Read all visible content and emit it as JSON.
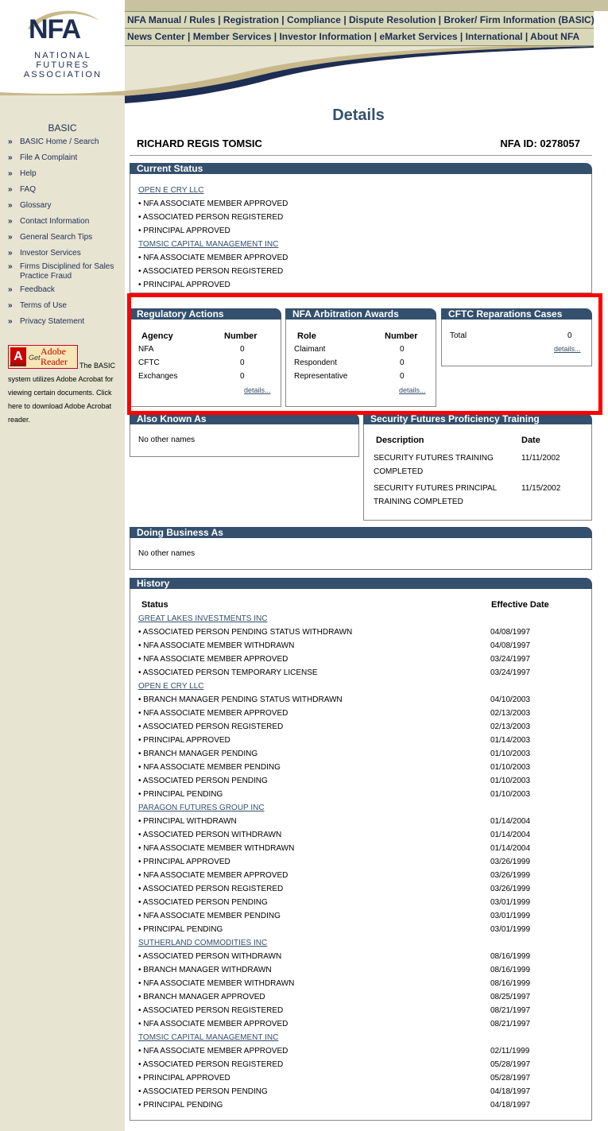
{
  "logo": {
    "mark": "NFA",
    "line1": "NATIONAL",
    "line2": "FUTURES",
    "line3": "ASSOCIATION"
  },
  "nav": {
    "row1": "NFA Manual / Rules | Registration | Compliance | Dispute Resolution | Broker/ Firm Information (BASIC)",
    "row2": "News Center | Member Services | Investor Information | eMarket Services | International | About NFA"
  },
  "sidebar": {
    "title": "BASIC",
    "items": [
      "BASIC Home / Search",
      "File A Complaint",
      "Help",
      "FAQ",
      "Glossary",
      "Contact Information",
      "General Search Tips",
      "Investor Services",
      "Firms Disciplined for Sales Practice Fraud",
      "Feedback",
      "Terms of Use",
      "Privacy Statement"
    ],
    "adobe": {
      "a": "A",
      "get": "Get",
      "reader": "Adobe Reader",
      "small": "Adobe",
      "text": "The BASIC system utilizes Adobe Acrobat for viewing certain documents. Click here to download Adobe Acrobat reader."
    }
  },
  "page": {
    "title": "Details",
    "name": "RICHARD REGIS TOMSIC",
    "nfa_id": "NFA ID: 0278057"
  },
  "current_status": {
    "title": "Current Status",
    "lines": [
      {
        "text": "OPEN E CRY LLC",
        "link": true
      },
      {
        "text": "• NFA ASSOCIATE MEMBER APPROVED",
        "link": false
      },
      {
        "text": "• ASSOCIATED PERSON REGISTERED",
        "link": false
      },
      {
        "text": "• PRINCIPAL APPROVED",
        "link": false
      },
      {
        "text": "TOMSIC CAPITAL MANAGEMENT INC",
        "link": true
      },
      {
        "text": "• NFA ASSOCIATE MEMBER APPROVED",
        "link": false
      },
      {
        "text": "• ASSOCIATED PERSON REGISTERED",
        "link": false
      },
      {
        "text": "• PRINCIPAL APPROVED",
        "link": false
      }
    ]
  },
  "regulatory": {
    "title": "Regulatory Actions",
    "col1": "Agency",
    "col2": "Number",
    "rows": [
      [
        "NFA",
        "0"
      ],
      [
        "CFTC",
        "0"
      ],
      [
        "Exchanges",
        "0"
      ]
    ],
    "details": "details..."
  },
  "arbitration": {
    "title": "NFA Arbitration Awards",
    "col1": "Role",
    "col2": "Number",
    "rows": [
      [
        "Claimant",
        "0"
      ],
      [
        "Respondent",
        "0"
      ],
      [
        "Representative",
        "0"
      ]
    ],
    "details": "details..."
  },
  "cftc": {
    "title": "CFTC Reparations Cases",
    "label": "Total",
    "value": "0",
    "details": "details..."
  },
  "aka": {
    "title": "Also Known As",
    "text": "No other names"
  },
  "training": {
    "title": "Security Futures Proficiency Training",
    "col1": "Description",
    "col2": "Date",
    "rows": [
      {
        "desc1": "SECURITY FUTURES TRAINING",
        "desc2": "COMPLETED",
        "date": "11/11/2002"
      },
      {
        "desc1": "SECURITY FUTURES PRINCIPAL",
        "desc2": "TRAINING COMPLETED",
        "date": "11/15/2002"
      }
    ]
  },
  "dba": {
    "title": "Doing Business As",
    "text": "No other names"
  },
  "history": {
    "title": "History",
    "col1": "Status",
    "col2": "Effective Date",
    "rows": [
      {
        "text": "GREAT LAKES INVESTMENTS INC",
        "link": true,
        "date": ""
      },
      {
        "text": "• ASSOCIATED PERSON PENDING STATUS WITHDRAWN",
        "link": false,
        "date": "04/08/1997"
      },
      {
        "text": "• NFA ASSOCIATE MEMBER WITHDRAWN",
        "link": false,
        "date": "04/08/1997"
      },
      {
        "text": "• NFA ASSOCIATE MEMBER APPROVED",
        "link": false,
        "date": "03/24/1997"
      },
      {
        "text": "• ASSOCIATED PERSON TEMPORARY LICENSE",
        "link": false,
        "date": "03/24/1997"
      },
      {
        "text": "OPEN E CRY LLC",
        "link": true,
        "date": ""
      },
      {
        "text": "• BRANCH MANAGER PENDING STATUS WITHDRAWN",
        "link": false,
        "date": "04/10/2003"
      },
      {
        "text": "• NFA ASSOCIATE MEMBER APPROVED",
        "link": false,
        "date": "02/13/2003"
      },
      {
        "text": "• ASSOCIATED PERSON REGISTERED",
        "link": false,
        "date": "02/13/2003"
      },
      {
        "text": "• PRINCIPAL APPROVED",
        "link": false,
        "date": "01/14/2003"
      },
      {
        "text": "• BRANCH MANAGER PENDING",
        "link": false,
        "date": "01/10/2003"
      },
      {
        "text": "• NFA ASSOCIATE MEMBER PENDING",
        "link": false,
        "date": "01/10/2003"
      },
      {
        "text": "• ASSOCIATED PERSON PENDING",
        "link": false,
        "date": "01/10/2003"
      },
      {
        "text": "• PRINCIPAL PENDING",
        "link": false,
        "date": "01/10/2003"
      },
      {
        "text": "PARAGON FUTURES GROUP INC",
        "link": true,
        "date": ""
      },
      {
        "text": "• PRINCIPAL WITHDRAWN",
        "link": false,
        "date": "01/14/2004"
      },
      {
        "text": "• ASSOCIATED PERSON WITHDRAWN",
        "link": false,
        "date": "01/14/2004"
      },
      {
        "text": "• NFA ASSOCIATE MEMBER WITHDRAWN",
        "link": false,
        "date": "01/14/2004"
      },
      {
        "text": "• PRINCIPAL APPROVED",
        "link": false,
        "date": "03/26/1999"
      },
      {
        "text": "• NFA ASSOCIATE MEMBER APPROVED",
        "link": false,
        "date": "03/26/1999"
      },
      {
        "text": "• ASSOCIATED PERSON REGISTERED",
        "link": false,
        "date": "03/26/1999"
      },
      {
        "text": "• ASSOCIATED PERSON PENDING",
        "link": false,
        "date": "03/01/1999"
      },
      {
        "text": "• NFA ASSOCIATE MEMBER PENDING",
        "link": false,
        "date": "03/01/1999"
      },
      {
        "text": "• PRINCIPAL PENDING",
        "link": false,
        "date": "03/01/1999"
      },
      {
        "text": "SUTHERLAND COMMODITIES INC",
        "link": true,
        "date": ""
      },
      {
        "text": "• ASSOCIATED PERSON WITHDRAWN",
        "link": false,
        "date": "08/16/1999"
      },
      {
        "text": "• BRANCH MANAGER WITHDRAWN",
        "link": false,
        "date": "08/16/1999"
      },
      {
        "text": "• NFA ASSOCIATE MEMBER WITHDRAWN",
        "link": false,
        "date": "08/16/1999"
      },
      {
        "text": "• BRANCH MANAGER APPROVED",
        "link": false,
        "date": "08/25/1997"
      },
      {
        "text": "• ASSOCIATED PERSON REGISTERED",
        "link": false,
        "date": "08/21/1997"
      },
      {
        "text": "• NFA ASSOCIATE MEMBER APPROVED",
        "link": false,
        "date": "08/21/1997"
      },
      {
        "text": "TOMSIC CAPITAL MANAGEMENT INC",
        "link": true,
        "date": ""
      },
      {
        "text": "• NFA ASSOCIATE MEMBER APPROVED",
        "link": false,
        "date": "02/11/1999"
      },
      {
        "text": "• ASSOCIATED PERSON REGISTERED",
        "link": false,
        "date": "05/28/1997"
      },
      {
        "text": "• PRINCIPAL APPROVED",
        "link": false,
        "date": "05/28/1997"
      },
      {
        "text": "• ASSOCIATED PERSON PENDING",
        "link": false,
        "date": "04/18/1997"
      },
      {
        "text": "• PRINCIPAL PENDING",
        "link": false,
        "date": "04/18/1997"
      }
    ]
  },
  "colors": {
    "navy": "#1e2d52",
    "panel_header": "#34506d",
    "sidebar": "#e7e4d2",
    "nav_bg": "#d8d8b8",
    "highlight": "#ff0000",
    "swoosh": "#c8b98a"
  }
}
